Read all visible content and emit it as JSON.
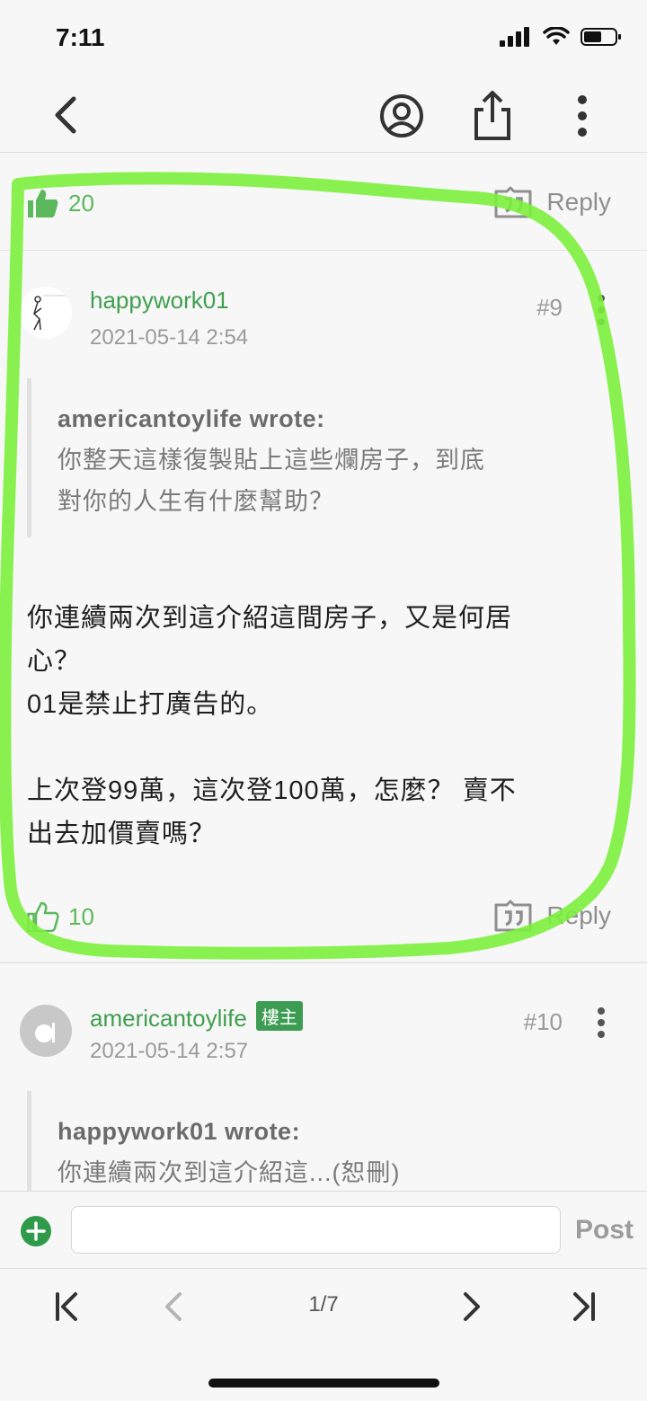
{
  "status_bar": {
    "time": "7:11"
  },
  "colors": {
    "accent_green": "#3f9f4f",
    "like_green": "#5cb85c",
    "highlight_stroke": "#7cf03c",
    "op_badge_bg": "#3c9d52"
  },
  "icons": [
    "back-chevron-icon",
    "profile-icon",
    "share-icon",
    "more-vertical-icon",
    "thumbs-up-icon",
    "reply-quote-icon",
    "add-icon",
    "first-page-icon",
    "prev-page-icon",
    "next-page-icon",
    "last-page-icon"
  ],
  "previous_post": {
    "likes": "20",
    "reply_label": "Reply"
  },
  "post9": {
    "username": "happywork01",
    "timestamp": "2021-05-14 2:54",
    "floor": "#9",
    "quote_author": "americantoylife wrote:",
    "quote_text": "你整天這樣復製貼上這些爛房子，到底\n對你的人生有什麼幫助？",
    "body": "你連續兩次到這介紹這間房子，又是何居\n心？\n01是禁止打廣告的。\n\n上次登99萬，這次登100萬，怎麼？ 賣不\n出去加價賣嗎？",
    "likes": "10",
    "reply_label": "Reply"
  },
  "post10": {
    "username": "americantoylife",
    "op_badge": "樓主",
    "timestamp": "2021-05-14 2:57",
    "floor": "#10",
    "quote_author": "happywork01 wrote:",
    "quote_text": "你連續兩次到這介紹這...(恕刪)"
  },
  "input_bar": {
    "placeholder": "",
    "post_label": "Post"
  },
  "pager": {
    "page_indicator": "1/7"
  }
}
